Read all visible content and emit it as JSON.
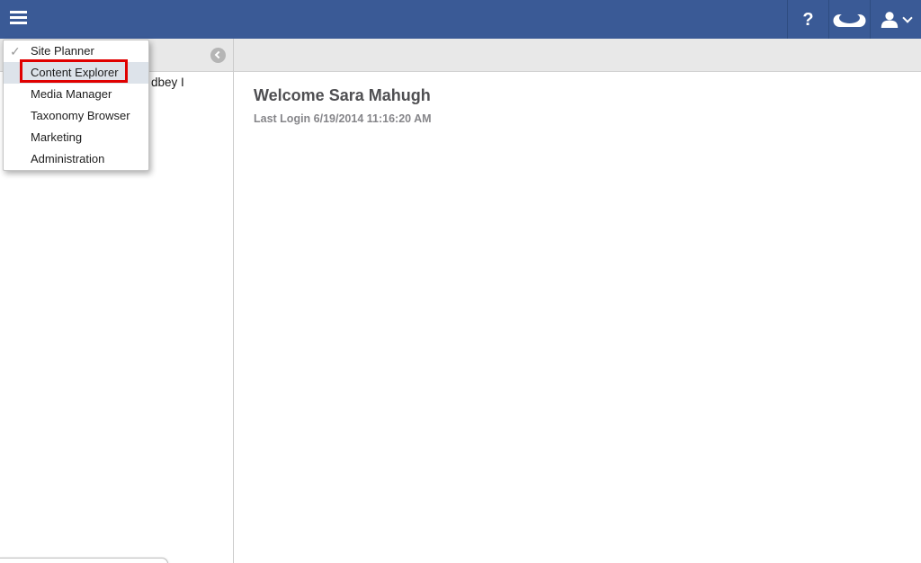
{
  "topbar": {
    "hamburger_icon": "hamburger-icon",
    "help_glyph": "?",
    "goggles_icon": "goggles-icon",
    "user_icon": "user-icon",
    "chevron_down_icon": "chevron-down-icon"
  },
  "nav_dropdown": {
    "check_glyph": "✓",
    "items": [
      {
        "label": "Site Planner",
        "checked": true,
        "highlighted": false
      },
      {
        "label": "Content Explorer",
        "checked": false,
        "highlighted": true
      },
      {
        "label": "Media Manager",
        "checked": false,
        "highlighted": false
      },
      {
        "label": "Taxonomy Browser",
        "checked": false,
        "highlighted": false
      },
      {
        "label": "Marketing",
        "checked": false,
        "highlighted": false
      },
      {
        "label": "Administration",
        "checked": false,
        "highlighted": false
      }
    ],
    "annotation_box": {
      "target": "Content Explorer",
      "color": "#e00000"
    }
  },
  "finder": {
    "back_icon": "chevron-left-circle-icon",
    "partial_tree_text": "dbey I"
  },
  "main": {
    "welcome_heading": "Welcome Sara Mahugh",
    "last_login": "Last Login 6/19/2014 11:16:20 AM"
  },
  "colors": {
    "topbar_bg": "#3a5a96",
    "topbar_divider": "#2e4c80",
    "toolbar_bg": "#e8e8e8",
    "toolbar_border": "#d2d2d2",
    "panel_divider": "#cbcbcb",
    "menu_highlight_bg": "#dde3ea",
    "annotation_red": "#e00000",
    "heading_text": "#4f4f52",
    "login_text": "#86868a",
    "back_circle": "#b5b5b5"
  }
}
